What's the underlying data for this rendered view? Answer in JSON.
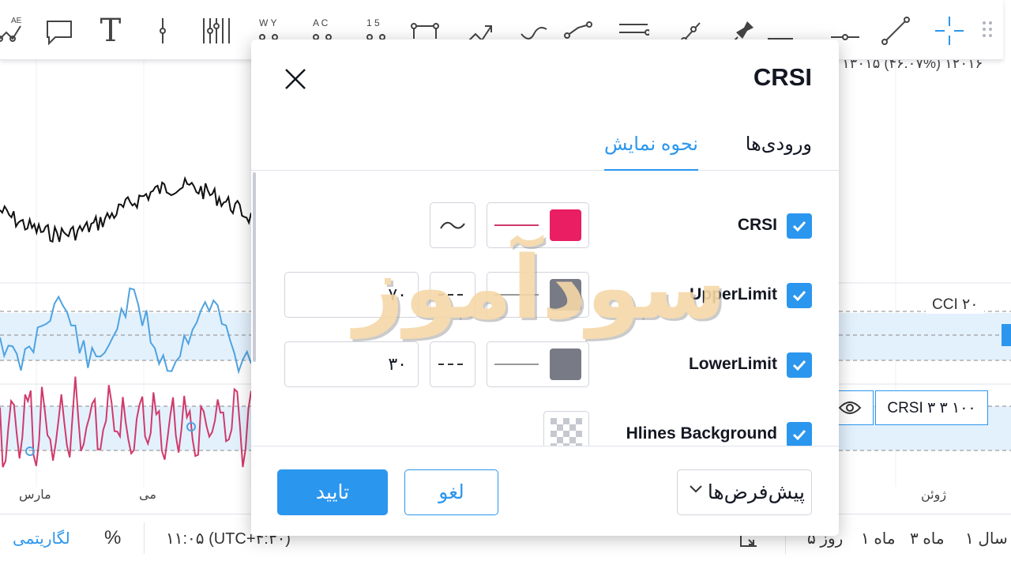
{
  "toolbar": {
    "tools": [
      {
        "icon": "ab-cd-pattern-icon",
        "label": "AE"
      },
      {
        "icon": "callout-icon"
      },
      {
        "icon": "text-icon",
        "label": "T"
      },
      {
        "icon": "vertical-line-icon"
      },
      {
        "icon": "fib-channels-icon"
      },
      {
        "icon": "wxy-wave-icon",
        "label": "W Y"
      },
      {
        "icon": "abcd-pattern-icon",
        "label": "A C"
      },
      {
        "icon": "elliott-wave-icon",
        "label": "1 5"
      },
      {
        "icon": "path-icon"
      },
      {
        "icon": "arrow-path-icon"
      },
      {
        "icon": "curve-icon"
      },
      {
        "icon": "polyline-icon"
      },
      {
        "icon": "parallel-channel-icon"
      },
      {
        "icon": "ray-icon"
      },
      {
        "icon": "pin-icon"
      },
      {
        "icon": "horizontal-ray-icon"
      },
      {
        "icon": "horizontal-line-icon"
      },
      {
        "icon": "trend-line-icon"
      },
      {
        "icon": "crosshair-icon"
      },
      {
        "icon": "drag-handle-icon"
      }
    ]
  },
  "chart": {
    "header_text": "۱۳۰۱۵  (۴۶.۰۷%)  ۱۲۰۱۶",
    "cci_label": "CCI ۲۰",
    "crsi_legend": "CRSI ۳ ۳ ۱۰۰",
    "x_labels": [
      "مارس",
      "می",
      "ژوئن"
    ]
  },
  "statusbar": {
    "log_label": "لگاریتمی",
    "percent_label": "%",
    "timezone": "۱۱:۰۵ (UTC+۴:۳۰)",
    "ranges": [
      "۱ سال",
      "۳ ماه",
      "۱ ماه",
      "۵ روز"
    ]
  },
  "dialog": {
    "title": "CRSI",
    "tabs": [
      {
        "label": "ورودی‌ها",
        "active": false
      },
      {
        "label": "نحوه نمایش",
        "active": true
      }
    ],
    "rows": [
      {
        "label": "CRSI",
        "checked": true,
        "color": "#e91e63"
      },
      {
        "label": "UpperLimit",
        "checked": true,
        "color": "#787b86",
        "value": "۷۰"
      },
      {
        "label": "LowerLimit",
        "checked": true,
        "color": "#787b86",
        "value": "۳۰"
      },
      {
        "label": "Hlines Background",
        "checked": true
      }
    ],
    "buttons": {
      "ok": "تایید",
      "cancel": "لغو",
      "defaults": "پیش‌فرض‌ها"
    }
  },
  "watermark": "سودآموز",
  "colors": {
    "accent": "#2b96ee",
    "crsi_line": "#e91e63",
    "cci_line": "#4fa3e0",
    "band_fill": "#e3f1fd"
  }
}
